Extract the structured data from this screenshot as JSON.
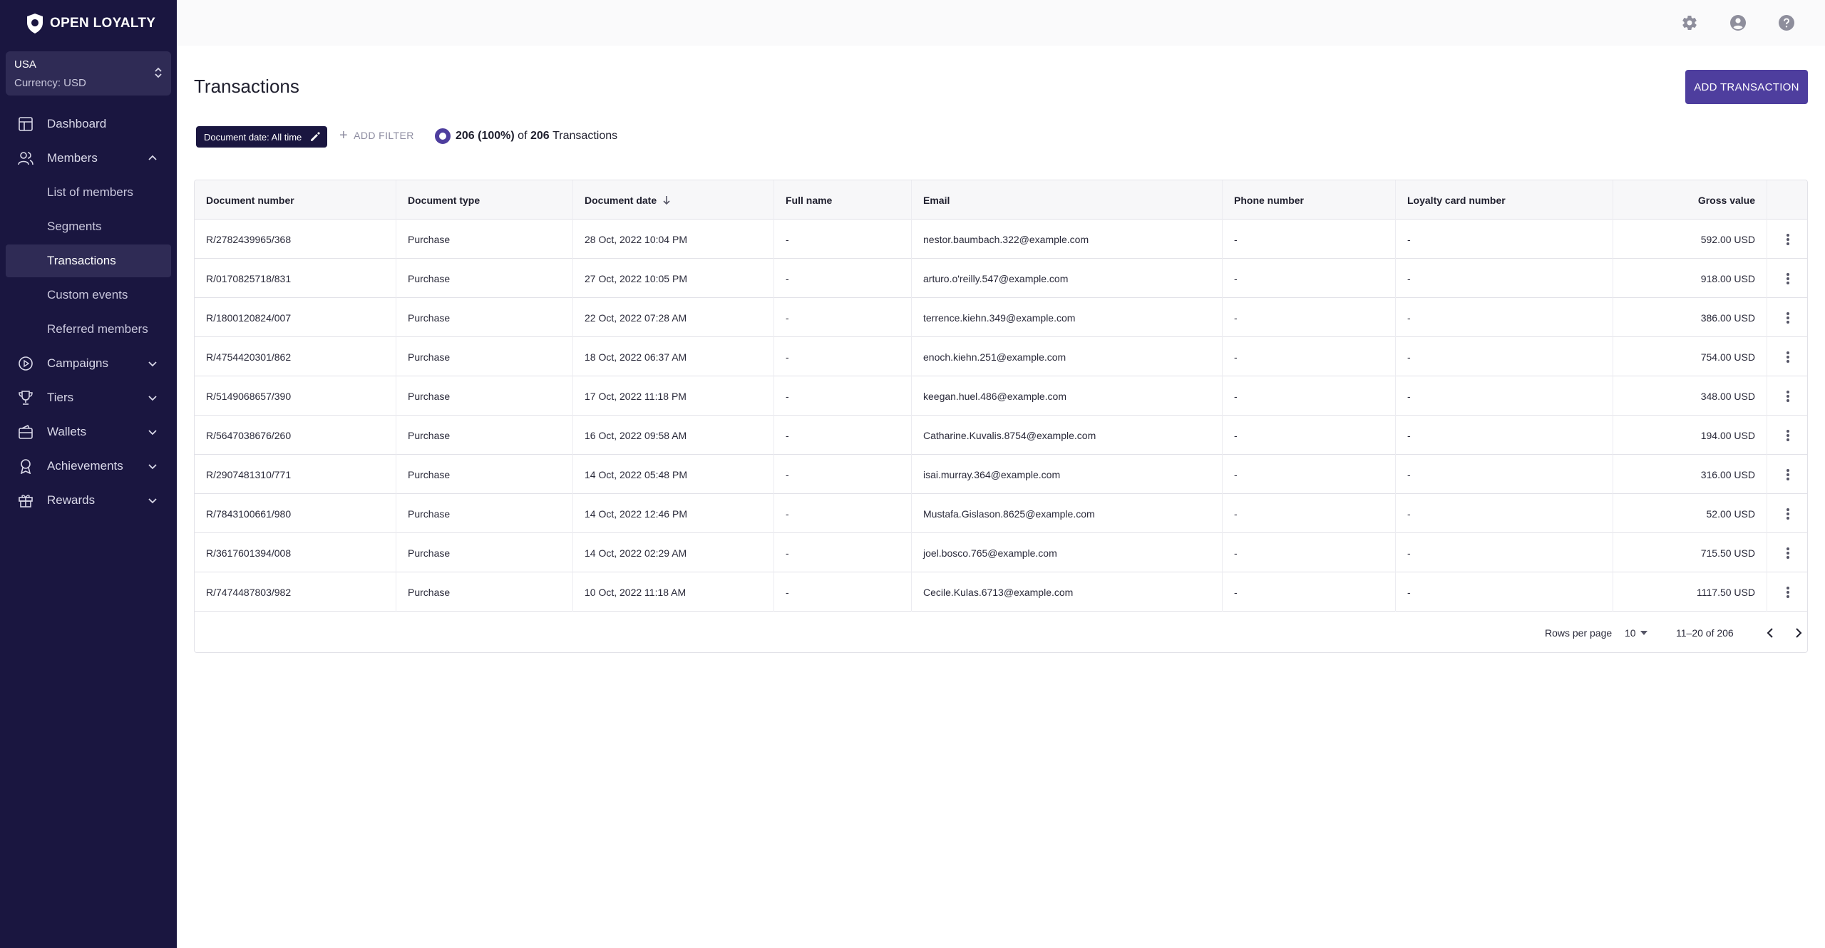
{
  "app": {
    "logo_text": "OPEN LOYALTY"
  },
  "region": {
    "name": "USA",
    "currency": "Currency: USD"
  },
  "sidebar": {
    "items": [
      {
        "label": "Dashboard"
      },
      {
        "label": "Members"
      },
      {
        "label": "Campaigns"
      },
      {
        "label": "Tiers"
      },
      {
        "label": "Wallets"
      },
      {
        "label": "Achievements"
      },
      {
        "label": "Rewards"
      }
    ],
    "members_sub": [
      {
        "label": "List of members"
      },
      {
        "label": "Segments"
      },
      {
        "label": "Transactions"
      },
      {
        "label": "Custom events"
      },
      {
        "label": "Referred members"
      }
    ]
  },
  "page": {
    "title": "Transactions",
    "add_button": "ADD TRANSACTION",
    "filter_chip": "Document date: All time",
    "add_filter": "ADD FILTER",
    "count_shown": "206 (100%)",
    "count_of": "of",
    "count_total": "206",
    "count_label": "Transactions"
  },
  "table": {
    "columns": [
      "Document number",
      "Document type",
      "Document date",
      "Full name",
      "Email",
      "Phone number",
      "Loyalty card number",
      "Gross value"
    ],
    "rows": [
      {
        "doc": "R/2782439965/368",
        "type": "Purchase",
        "date": "28 Oct, 2022 10:04 PM",
        "name": "-",
        "email": "nestor.baumbach.322@example.com",
        "phone": "-",
        "card": "-",
        "gross": "592.00 USD"
      },
      {
        "doc": "R/0170825718/831",
        "type": "Purchase",
        "date": "27 Oct, 2022 10:05 PM",
        "name": "-",
        "email": "arturo.o'reilly.547@example.com",
        "phone": "-",
        "card": "-",
        "gross": "918.00 USD"
      },
      {
        "doc": "R/1800120824/007",
        "type": "Purchase",
        "date": "22 Oct, 2022 07:28 AM",
        "name": "-",
        "email": "terrence.kiehn.349@example.com",
        "phone": "-",
        "card": "-",
        "gross": "386.00 USD"
      },
      {
        "doc": "R/4754420301/862",
        "type": "Purchase",
        "date": "18 Oct, 2022 06:37 AM",
        "name": "-",
        "email": "enoch.kiehn.251@example.com",
        "phone": "-",
        "card": "-",
        "gross": "754.00 USD"
      },
      {
        "doc": "R/5149068657/390",
        "type": "Purchase",
        "date": "17 Oct, 2022 11:18 PM",
        "name": "-",
        "email": "keegan.huel.486@example.com",
        "phone": "-",
        "card": "-",
        "gross": "348.00 USD"
      },
      {
        "doc": "R/5647038676/260",
        "type": "Purchase",
        "date": "16 Oct, 2022 09:58 AM",
        "name": "-",
        "email": "Catharine.Kuvalis.8754@example.com",
        "phone": "-",
        "card": "-",
        "gross": "194.00 USD"
      },
      {
        "doc": "R/2907481310/771",
        "type": "Purchase",
        "date": "14 Oct, 2022 05:48 PM",
        "name": "-",
        "email": "isai.murray.364@example.com",
        "phone": "-",
        "card": "-",
        "gross": "316.00 USD"
      },
      {
        "doc": "R/7843100661/980",
        "type": "Purchase",
        "date": "14 Oct, 2022 12:46 PM",
        "name": "-",
        "email": "Mustafa.Gislason.8625@example.com",
        "phone": "-",
        "card": "-",
        "gross": "52.00 USD"
      },
      {
        "doc": "R/3617601394/008",
        "type": "Purchase",
        "date": "14 Oct, 2022 02:29 AM",
        "name": "-",
        "email": "joel.bosco.765@example.com",
        "phone": "-",
        "card": "-",
        "gross": "715.50 USD"
      },
      {
        "doc": "R/7474487803/982",
        "type": "Purchase",
        "date": "10 Oct, 2022 11:18 AM",
        "name": "-",
        "email": "Cecile.Kulas.6713@example.com",
        "phone": "-",
        "card": "-",
        "gross": "1117.50 USD"
      }
    ]
  },
  "pagination": {
    "rows_per_page_label": "Rows per page",
    "rows_per_page": "10",
    "range": "11–20 of 206"
  },
  "colors": {
    "sidebar_bg": "#1a1640",
    "accent": "#4e3e9e",
    "active_item_bg": "#2f2b55"
  }
}
